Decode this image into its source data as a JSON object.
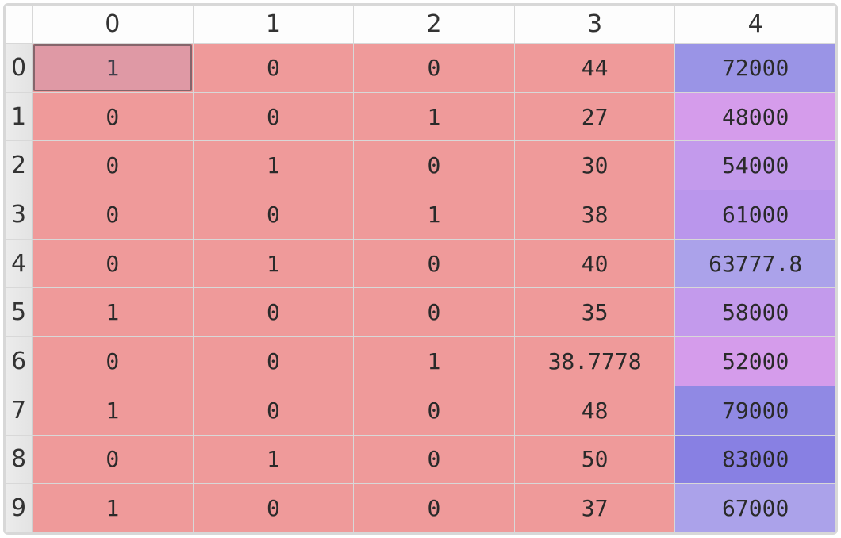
{
  "columns": [
    "0",
    "1",
    "2",
    "3",
    "4"
  ],
  "rowLabels": [
    "0",
    "1",
    "2",
    "3",
    "4",
    "5",
    "6",
    "7",
    "8",
    "9"
  ],
  "cells": [
    [
      {
        "v": "1",
        "c": "c-pink",
        "sel": true
      },
      {
        "v": "0",
        "c": "c-pink"
      },
      {
        "v": "0",
        "c": "c-pink"
      },
      {
        "v": "44",
        "c": "c-pink"
      },
      {
        "v": "72000",
        "c": "c-blue1"
      }
    ],
    [
      {
        "v": "0",
        "c": "c-pink"
      },
      {
        "v": "0",
        "c": "c-pink"
      },
      {
        "v": "1",
        "c": "c-pink"
      },
      {
        "v": "27",
        "c": "c-pink"
      },
      {
        "v": "48000",
        "c": "c-lilac"
      }
    ],
    [
      {
        "v": "0",
        "c": "c-pink"
      },
      {
        "v": "1",
        "c": "c-pink"
      },
      {
        "v": "0",
        "c": "c-pink"
      },
      {
        "v": "30",
        "c": "c-pink"
      },
      {
        "v": "54000",
        "c": "c-violet"
      }
    ],
    [
      {
        "v": "0",
        "c": "c-pink"
      },
      {
        "v": "0",
        "c": "c-pink"
      },
      {
        "v": "1",
        "c": "c-pink"
      },
      {
        "v": "38",
        "c": "c-pink"
      },
      {
        "v": "61000",
        "c": "c-purple"
      }
    ],
    [
      {
        "v": "0",
        "c": "c-pink"
      },
      {
        "v": "1",
        "c": "c-pink"
      },
      {
        "v": "0",
        "c": "c-pink"
      },
      {
        "v": "40",
        "c": "c-pink"
      },
      {
        "v": "63777.8",
        "c": "c-lav"
      }
    ],
    [
      {
        "v": "1",
        "c": "c-pink"
      },
      {
        "v": "0",
        "c": "c-pink"
      },
      {
        "v": "0",
        "c": "c-pink"
      },
      {
        "v": "35",
        "c": "c-pink"
      },
      {
        "v": "58000",
        "c": "c-violet"
      }
    ],
    [
      {
        "v": "0",
        "c": "c-pink"
      },
      {
        "v": "0",
        "c": "c-pink"
      },
      {
        "v": "1",
        "c": "c-pink"
      },
      {
        "v": "38.7778",
        "c": "c-pink"
      },
      {
        "v": "52000",
        "c": "c-lilac"
      }
    ],
    [
      {
        "v": "1",
        "c": "c-pink"
      },
      {
        "v": "0",
        "c": "c-pink"
      },
      {
        "v": "0",
        "c": "c-pink"
      },
      {
        "v": "48",
        "c": "c-pink"
      },
      {
        "v": "79000",
        "c": "c-blue0"
      }
    ],
    [
      {
        "v": "0",
        "c": "c-pink"
      },
      {
        "v": "1",
        "c": "c-pink"
      },
      {
        "v": "0",
        "c": "c-pink"
      },
      {
        "v": "50",
        "c": "c-pink"
      },
      {
        "v": "83000",
        "c": "c-blue2"
      }
    ],
    [
      {
        "v": "1",
        "c": "c-pink"
      },
      {
        "v": "0",
        "c": "c-pink"
      },
      {
        "v": "0",
        "c": "c-pink"
      },
      {
        "v": "37",
        "c": "c-pink"
      },
      {
        "v": "67000",
        "c": "c-lav"
      }
    ]
  ]
}
